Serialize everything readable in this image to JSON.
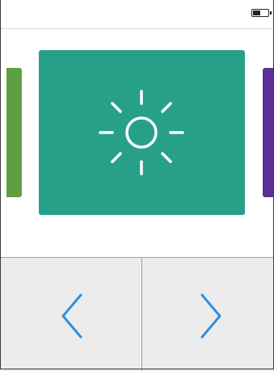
{
  "status_bar": {
    "battery_icon": "battery-icon",
    "battery_level": 0.5
  },
  "carousel": {
    "current_card": {
      "icon": "sun-icon",
      "color": "#27a08a"
    },
    "previous_card": {
      "color": "#5f9e43"
    },
    "next_card": {
      "color": "#5b3196"
    }
  },
  "navigation": {
    "previous_icon": "chevron-left-icon",
    "next_icon": "chevron-right-icon",
    "chevron_color": "#2f8fde",
    "panel_color": "#ececec"
  }
}
